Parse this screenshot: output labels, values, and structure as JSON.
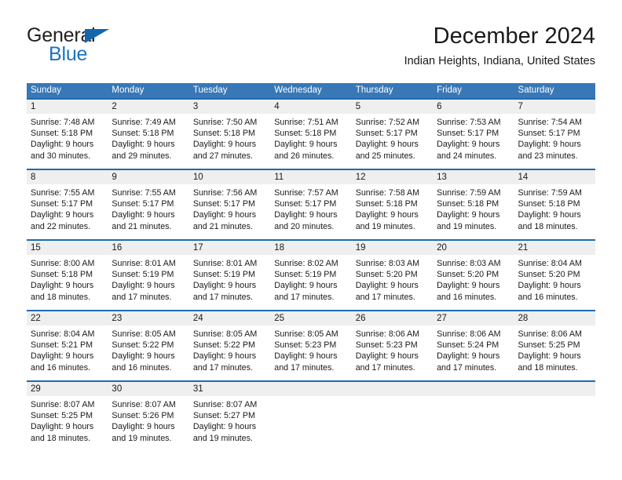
{
  "brand": {
    "name_top": "General",
    "name_bottom": "Blue",
    "accent_color": "#1a73c4",
    "triangle_color": "#1266ad"
  },
  "header": {
    "title": "December 2024",
    "subtitle": "Indian Heights, Indiana, United States"
  },
  "theme": {
    "header_bg": "#3878b6",
    "week_divider": "#1f6ab0",
    "daynum_bg": "#efefef",
    "text": "#1a1a1a"
  },
  "calendar": {
    "weekday_headers": [
      "Sunday",
      "Monday",
      "Tuesday",
      "Wednesday",
      "Thursday",
      "Friday",
      "Saturday"
    ],
    "weeks": [
      [
        {
          "day": "1",
          "sunrise": "Sunrise: 7:48 AM",
          "sunset": "Sunset: 5:18 PM",
          "daylight1": "Daylight: 9 hours",
          "daylight2": "and 30 minutes."
        },
        {
          "day": "2",
          "sunrise": "Sunrise: 7:49 AM",
          "sunset": "Sunset: 5:18 PM",
          "daylight1": "Daylight: 9 hours",
          "daylight2": "and 29 minutes."
        },
        {
          "day": "3",
          "sunrise": "Sunrise: 7:50 AM",
          "sunset": "Sunset: 5:18 PM",
          "daylight1": "Daylight: 9 hours",
          "daylight2": "and 27 minutes."
        },
        {
          "day": "4",
          "sunrise": "Sunrise: 7:51 AM",
          "sunset": "Sunset: 5:18 PM",
          "daylight1": "Daylight: 9 hours",
          "daylight2": "and 26 minutes."
        },
        {
          "day": "5",
          "sunrise": "Sunrise: 7:52 AM",
          "sunset": "Sunset: 5:17 PM",
          "daylight1": "Daylight: 9 hours",
          "daylight2": "and 25 minutes."
        },
        {
          "day": "6",
          "sunrise": "Sunrise: 7:53 AM",
          "sunset": "Sunset: 5:17 PM",
          "daylight1": "Daylight: 9 hours",
          "daylight2": "and 24 minutes."
        },
        {
          "day": "7",
          "sunrise": "Sunrise: 7:54 AM",
          "sunset": "Sunset: 5:17 PM",
          "daylight1": "Daylight: 9 hours",
          "daylight2": "and 23 minutes."
        }
      ],
      [
        {
          "day": "8",
          "sunrise": "Sunrise: 7:55 AM",
          "sunset": "Sunset: 5:17 PM",
          "daylight1": "Daylight: 9 hours",
          "daylight2": "and 22 minutes."
        },
        {
          "day": "9",
          "sunrise": "Sunrise: 7:55 AM",
          "sunset": "Sunset: 5:17 PM",
          "daylight1": "Daylight: 9 hours",
          "daylight2": "and 21 minutes."
        },
        {
          "day": "10",
          "sunrise": "Sunrise: 7:56 AM",
          "sunset": "Sunset: 5:17 PM",
          "daylight1": "Daylight: 9 hours",
          "daylight2": "and 21 minutes."
        },
        {
          "day": "11",
          "sunrise": "Sunrise: 7:57 AM",
          "sunset": "Sunset: 5:17 PM",
          "daylight1": "Daylight: 9 hours",
          "daylight2": "and 20 minutes."
        },
        {
          "day": "12",
          "sunrise": "Sunrise: 7:58 AM",
          "sunset": "Sunset: 5:18 PM",
          "daylight1": "Daylight: 9 hours",
          "daylight2": "and 19 minutes."
        },
        {
          "day": "13",
          "sunrise": "Sunrise: 7:59 AM",
          "sunset": "Sunset: 5:18 PM",
          "daylight1": "Daylight: 9 hours",
          "daylight2": "and 19 minutes."
        },
        {
          "day": "14",
          "sunrise": "Sunrise: 7:59 AM",
          "sunset": "Sunset: 5:18 PM",
          "daylight1": "Daylight: 9 hours",
          "daylight2": "and 18 minutes."
        }
      ],
      [
        {
          "day": "15",
          "sunrise": "Sunrise: 8:00 AM",
          "sunset": "Sunset: 5:18 PM",
          "daylight1": "Daylight: 9 hours",
          "daylight2": "and 18 minutes."
        },
        {
          "day": "16",
          "sunrise": "Sunrise: 8:01 AM",
          "sunset": "Sunset: 5:19 PM",
          "daylight1": "Daylight: 9 hours",
          "daylight2": "and 17 minutes."
        },
        {
          "day": "17",
          "sunrise": "Sunrise: 8:01 AM",
          "sunset": "Sunset: 5:19 PM",
          "daylight1": "Daylight: 9 hours",
          "daylight2": "and 17 minutes."
        },
        {
          "day": "18",
          "sunrise": "Sunrise: 8:02 AM",
          "sunset": "Sunset: 5:19 PM",
          "daylight1": "Daylight: 9 hours",
          "daylight2": "and 17 minutes."
        },
        {
          "day": "19",
          "sunrise": "Sunrise: 8:03 AM",
          "sunset": "Sunset: 5:20 PM",
          "daylight1": "Daylight: 9 hours",
          "daylight2": "and 17 minutes."
        },
        {
          "day": "20",
          "sunrise": "Sunrise: 8:03 AM",
          "sunset": "Sunset: 5:20 PM",
          "daylight1": "Daylight: 9 hours",
          "daylight2": "and 16 minutes."
        },
        {
          "day": "21",
          "sunrise": "Sunrise: 8:04 AM",
          "sunset": "Sunset: 5:20 PM",
          "daylight1": "Daylight: 9 hours",
          "daylight2": "and 16 minutes."
        }
      ],
      [
        {
          "day": "22",
          "sunrise": "Sunrise: 8:04 AM",
          "sunset": "Sunset: 5:21 PM",
          "daylight1": "Daylight: 9 hours",
          "daylight2": "and 16 minutes."
        },
        {
          "day": "23",
          "sunrise": "Sunrise: 8:05 AM",
          "sunset": "Sunset: 5:22 PM",
          "daylight1": "Daylight: 9 hours",
          "daylight2": "and 16 minutes."
        },
        {
          "day": "24",
          "sunrise": "Sunrise: 8:05 AM",
          "sunset": "Sunset: 5:22 PM",
          "daylight1": "Daylight: 9 hours",
          "daylight2": "and 17 minutes."
        },
        {
          "day": "25",
          "sunrise": "Sunrise: 8:05 AM",
          "sunset": "Sunset: 5:23 PM",
          "daylight1": "Daylight: 9 hours",
          "daylight2": "and 17 minutes."
        },
        {
          "day": "26",
          "sunrise": "Sunrise: 8:06 AM",
          "sunset": "Sunset: 5:23 PM",
          "daylight1": "Daylight: 9 hours",
          "daylight2": "and 17 minutes."
        },
        {
          "day": "27",
          "sunrise": "Sunrise: 8:06 AM",
          "sunset": "Sunset: 5:24 PM",
          "daylight1": "Daylight: 9 hours",
          "daylight2": "and 17 minutes."
        },
        {
          "day": "28",
          "sunrise": "Sunrise: 8:06 AM",
          "sunset": "Sunset: 5:25 PM",
          "daylight1": "Daylight: 9 hours",
          "daylight2": "and 18 minutes."
        }
      ],
      [
        {
          "day": "29",
          "sunrise": "Sunrise: 8:07 AM",
          "sunset": "Sunset: 5:25 PM",
          "daylight1": "Daylight: 9 hours",
          "daylight2": "and 18 minutes."
        },
        {
          "day": "30",
          "sunrise": "Sunrise: 8:07 AM",
          "sunset": "Sunset: 5:26 PM",
          "daylight1": "Daylight: 9 hours",
          "daylight2": "and 19 minutes."
        },
        {
          "day": "31",
          "sunrise": "Sunrise: 8:07 AM",
          "sunset": "Sunset: 5:27 PM",
          "daylight1": "Daylight: 9 hours",
          "daylight2": "and 19 minutes."
        },
        {
          "day": "",
          "sunrise": "",
          "sunset": "",
          "daylight1": "",
          "daylight2": ""
        },
        {
          "day": "",
          "sunrise": "",
          "sunset": "",
          "daylight1": "",
          "daylight2": ""
        },
        {
          "day": "",
          "sunrise": "",
          "sunset": "",
          "daylight1": "",
          "daylight2": ""
        },
        {
          "day": "",
          "sunrise": "",
          "sunset": "",
          "daylight1": "",
          "daylight2": ""
        }
      ]
    ]
  }
}
